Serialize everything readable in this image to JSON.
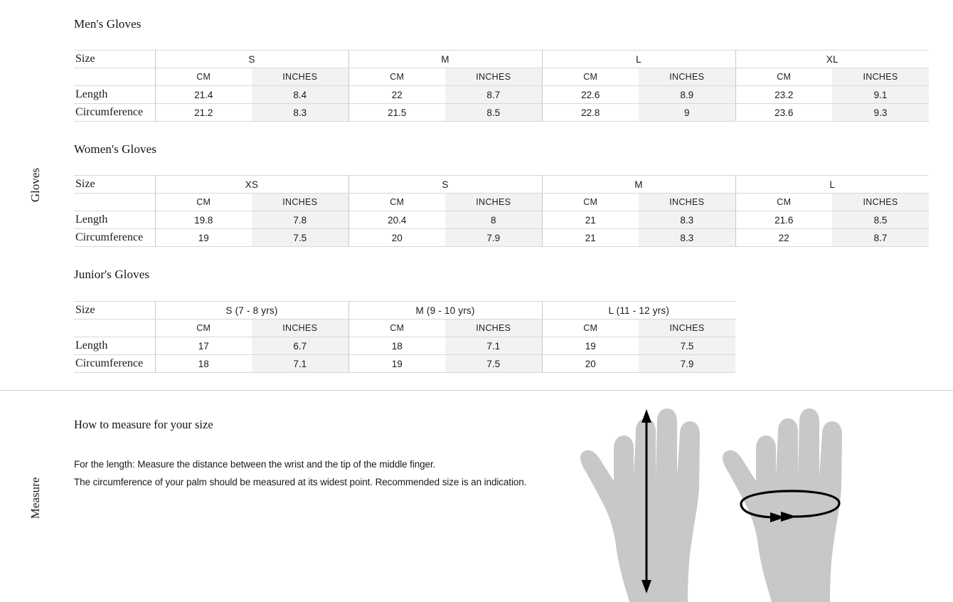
{
  "side_labels": {
    "gloves": "Gloves",
    "measure": "Measure"
  },
  "units": {
    "cm": "CM",
    "inches": "INCHES"
  },
  "row_header": "Size",
  "rows": {
    "length": "Length",
    "circumference": "Circumference"
  },
  "tables": [
    {
      "heading": "Men's Gloves",
      "groups": [
        "S",
        "M",
        "L",
        "XL"
      ],
      "length_cm": [
        "21.4",
        "22",
        "22.6",
        "23.2"
      ],
      "length_in": [
        "8.4",
        "8.7",
        "8.9",
        "9.1"
      ],
      "circ_cm": [
        "21.2",
        "21.5",
        "22.8",
        "23.6"
      ],
      "circ_in": [
        "8.3",
        "8.5",
        "9",
        "9.3"
      ]
    },
    {
      "heading": "Women's Gloves",
      "groups": [
        "XS",
        "S",
        "M",
        "L"
      ],
      "length_cm": [
        "19.8",
        "20.4",
        "21",
        "21.6"
      ],
      "length_in": [
        "7.8",
        "8",
        "8.3",
        "8.5"
      ],
      "circ_cm": [
        "19",
        "20",
        "21",
        "22"
      ],
      "circ_in": [
        "7.5",
        "7.9",
        "8.3",
        "8.7"
      ]
    },
    {
      "heading": "Junior's Gloves",
      "groups": [
        "S (7 - 8 yrs)",
        "M (9 - 10 yrs)",
        "L (11 - 12 yrs)"
      ],
      "length_cm": [
        "17",
        "18",
        "19"
      ],
      "length_in": [
        "6.7",
        "7.1",
        "7.5"
      ],
      "circ_cm": [
        "18",
        "19",
        "20"
      ],
      "circ_in": [
        "7.1",
        "7.5",
        "7.9"
      ]
    }
  ],
  "measure": {
    "title": "How to measure for your size",
    "line1": "For the length: Measure the distance between the wrist and the tip of the middle finger.",
    "line2": "The circumference of your palm should be measured at its widest point. Recommended size is an indication."
  },
  "illustration": {
    "hand_fill": "#c8c8c8",
    "arrow_color": "#000000",
    "left_hand_name": "length-measurement-hand",
    "right_hand_name": "circumference-measurement-hand"
  }
}
